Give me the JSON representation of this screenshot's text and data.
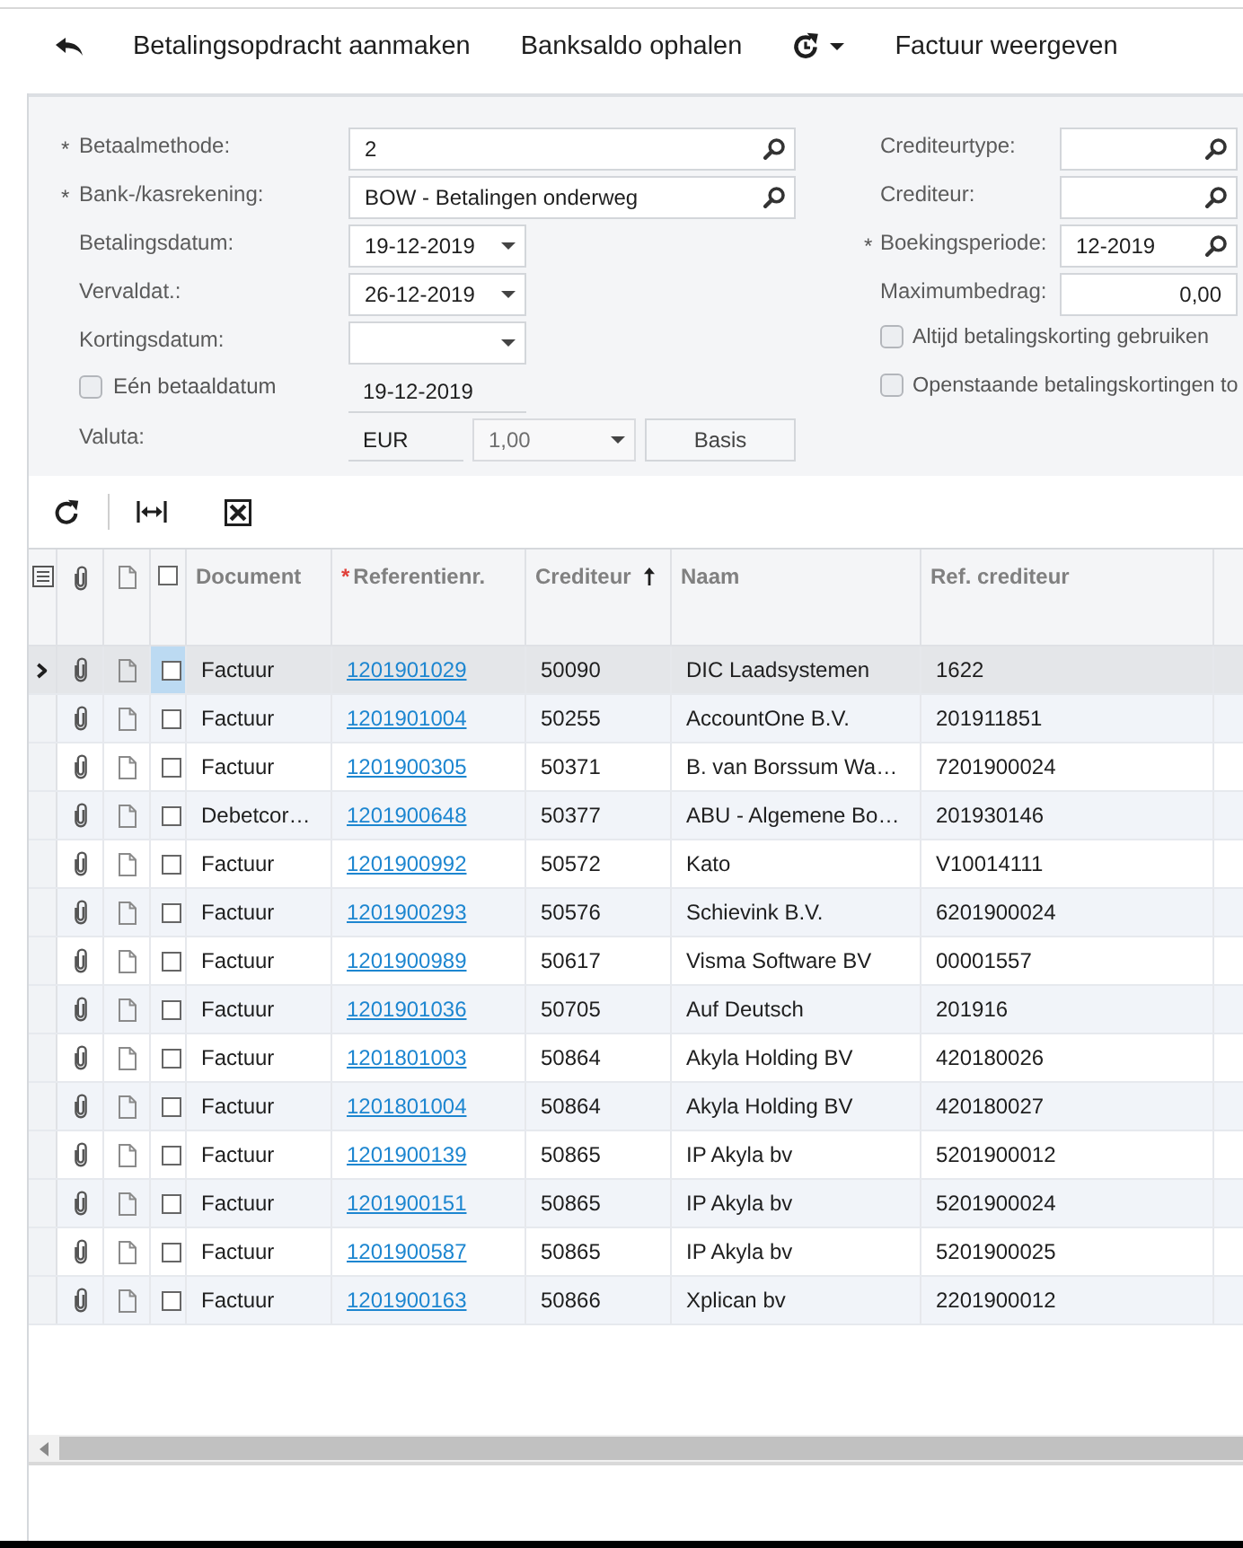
{
  "toolbar": [
    {
      "kind": "undo"
    },
    {
      "kind": "action",
      "label": "Betalingsopdracht aanmaken"
    },
    {
      "kind": "action",
      "label": "Banksaldo ophalen"
    },
    {
      "kind": "refresh_menu"
    },
    {
      "kind": "action",
      "label": "Factuur weergeven"
    }
  ],
  "form": {
    "left": [
      {
        "kind": "lookup",
        "marker": "*",
        "label": "Betaalmethode:",
        "value": "2"
      },
      {
        "kind": "lookup",
        "marker": "*",
        "label": "Bank-/kasrekening:",
        "value": "BOW - Betalingen onderweg"
      },
      {
        "kind": "date",
        "label": "Betalingsdatum:",
        "value": "19-12-2019"
      },
      {
        "kind": "date",
        "label": "Vervaldat.:",
        "value": "26-12-2019"
      },
      {
        "kind": "date",
        "label": "Kortingsdatum:"
      },
      {
        "kind": "check_readonly",
        "label": "Eén betaaldatum",
        "checked": false,
        "value": "19-12-2019"
      },
      {
        "kind": "currency",
        "label": "Valuta:",
        "value": "EUR",
        "rate": "1,00",
        "rate_disabled": true,
        "button": "Basis"
      }
    ],
    "right": [
      {
        "kind": "lookup",
        "label": "Crediteurtype:"
      },
      {
        "kind": "lookup",
        "label": "Crediteur:"
      },
      {
        "kind": "lookup",
        "marker": "*",
        "label": "Boekingsperiode:",
        "value": "12-2019"
      },
      {
        "kind": "number",
        "label": "Maximumbedrag:",
        "value": "0,00"
      },
      {
        "kind": "checkbox",
        "label": "Altijd betalingskorting gebruiken",
        "checked": false
      },
      {
        "kind": "checkbox",
        "label": "Openstaande betalingskortingen to",
        "checked": false
      }
    ]
  },
  "grid_toolbar": [
    {
      "kind": "refresh"
    },
    {
      "kind": "fit_columns"
    },
    {
      "kind": "export"
    }
  ],
  "grid": {
    "row_controls": [
      {
        "kind": "indicator"
      },
      {
        "kind": "attachment"
      },
      {
        "kind": "note"
      },
      {
        "kind": "select",
        "checked": false
      }
    ],
    "columns": [
      {
        "kind": "text",
        "label": "Document",
        "sorted": false
      },
      {
        "kind": "link",
        "marker": "*",
        "label": "Referentienr.",
        "sorted": false
      },
      {
        "kind": "text",
        "label": "Crediteur",
        "sorted": true
      },
      {
        "kind": "text",
        "label": "Naam",
        "sorted": false
      },
      {
        "kind": "text",
        "label": "Ref. crediteur",
        "sorted": false
      }
    ],
    "rows": [
      {
        "selected": true,
        "checked": false,
        "cells": [
          "Factuur",
          "1201901029",
          "50090",
          "DIC Laadsystemen",
          "1622"
        ]
      },
      {
        "selected": false,
        "checked": false,
        "cells": [
          "Factuur",
          "1201901004",
          "50255",
          "AccountOne B.V.",
          "201911851"
        ]
      },
      {
        "selected": false,
        "checked": false,
        "cells": [
          "Factuur",
          "1201900305",
          "50371",
          "B. van Borssum Wa…",
          "7201900024"
        ]
      },
      {
        "selected": false,
        "checked": false,
        "cells": [
          "Debetcor…",
          "1201900648",
          "50377",
          "ABU - Algemene Bo…",
          "201930146"
        ]
      },
      {
        "selected": false,
        "checked": false,
        "cells": [
          "Factuur",
          "1201900992",
          "50572",
          "Kato",
          "V10014111"
        ]
      },
      {
        "selected": false,
        "checked": false,
        "cells": [
          "Factuur",
          "1201900293",
          "50576",
          "Schievink B.V.",
          "6201900024"
        ]
      },
      {
        "selected": false,
        "checked": false,
        "cells": [
          "Factuur",
          "1201900989",
          "50617",
          "Visma Software BV",
          "00001557"
        ]
      },
      {
        "selected": false,
        "checked": false,
        "cells": [
          "Factuur",
          "1201901036",
          "50705",
          "Auf Deutsch",
          "201916"
        ]
      },
      {
        "selected": false,
        "checked": false,
        "cells": [
          "Factuur",
          "1201801003",
          "50864",
          "Akyla Holding BV",
          "420180026"
        ]
      },
      {
        "selected": false,
        "checked": false,
        "cells": [
          "Factuur",
          "1201801004",
          "50864",
          "Akyla Holding BV",
          "420180027"
        ]
      },
      {
        "selected": false,
        "checked": false,
        "cells": [
          "Factuur",
          "1201900139",
          "50865",
          "IP Akyla bv",
          "5201900012"
        ]
      },
      {
        "selected": false,
        "checked": false,
        "cells": [
          "Factuur",
          "1201900151",
          "50865",
          "IP Akyla bv",
          "5201900024"
        ]
      },
      {
        "selected": false,
        "checked": false,
        "cells": [
          "Factuur",
          "1201900587",
          "50865",
          "IP Akyla bv",
          "5201900025"
        ]
      },
      {
        "selected": false,
        "checked": false,
        "cells": [
          "Factuur",
          "1201900163",
          "50866",
          "Xplican bv",
          "2201900012"
        ]
      }
    ]
  }
}
